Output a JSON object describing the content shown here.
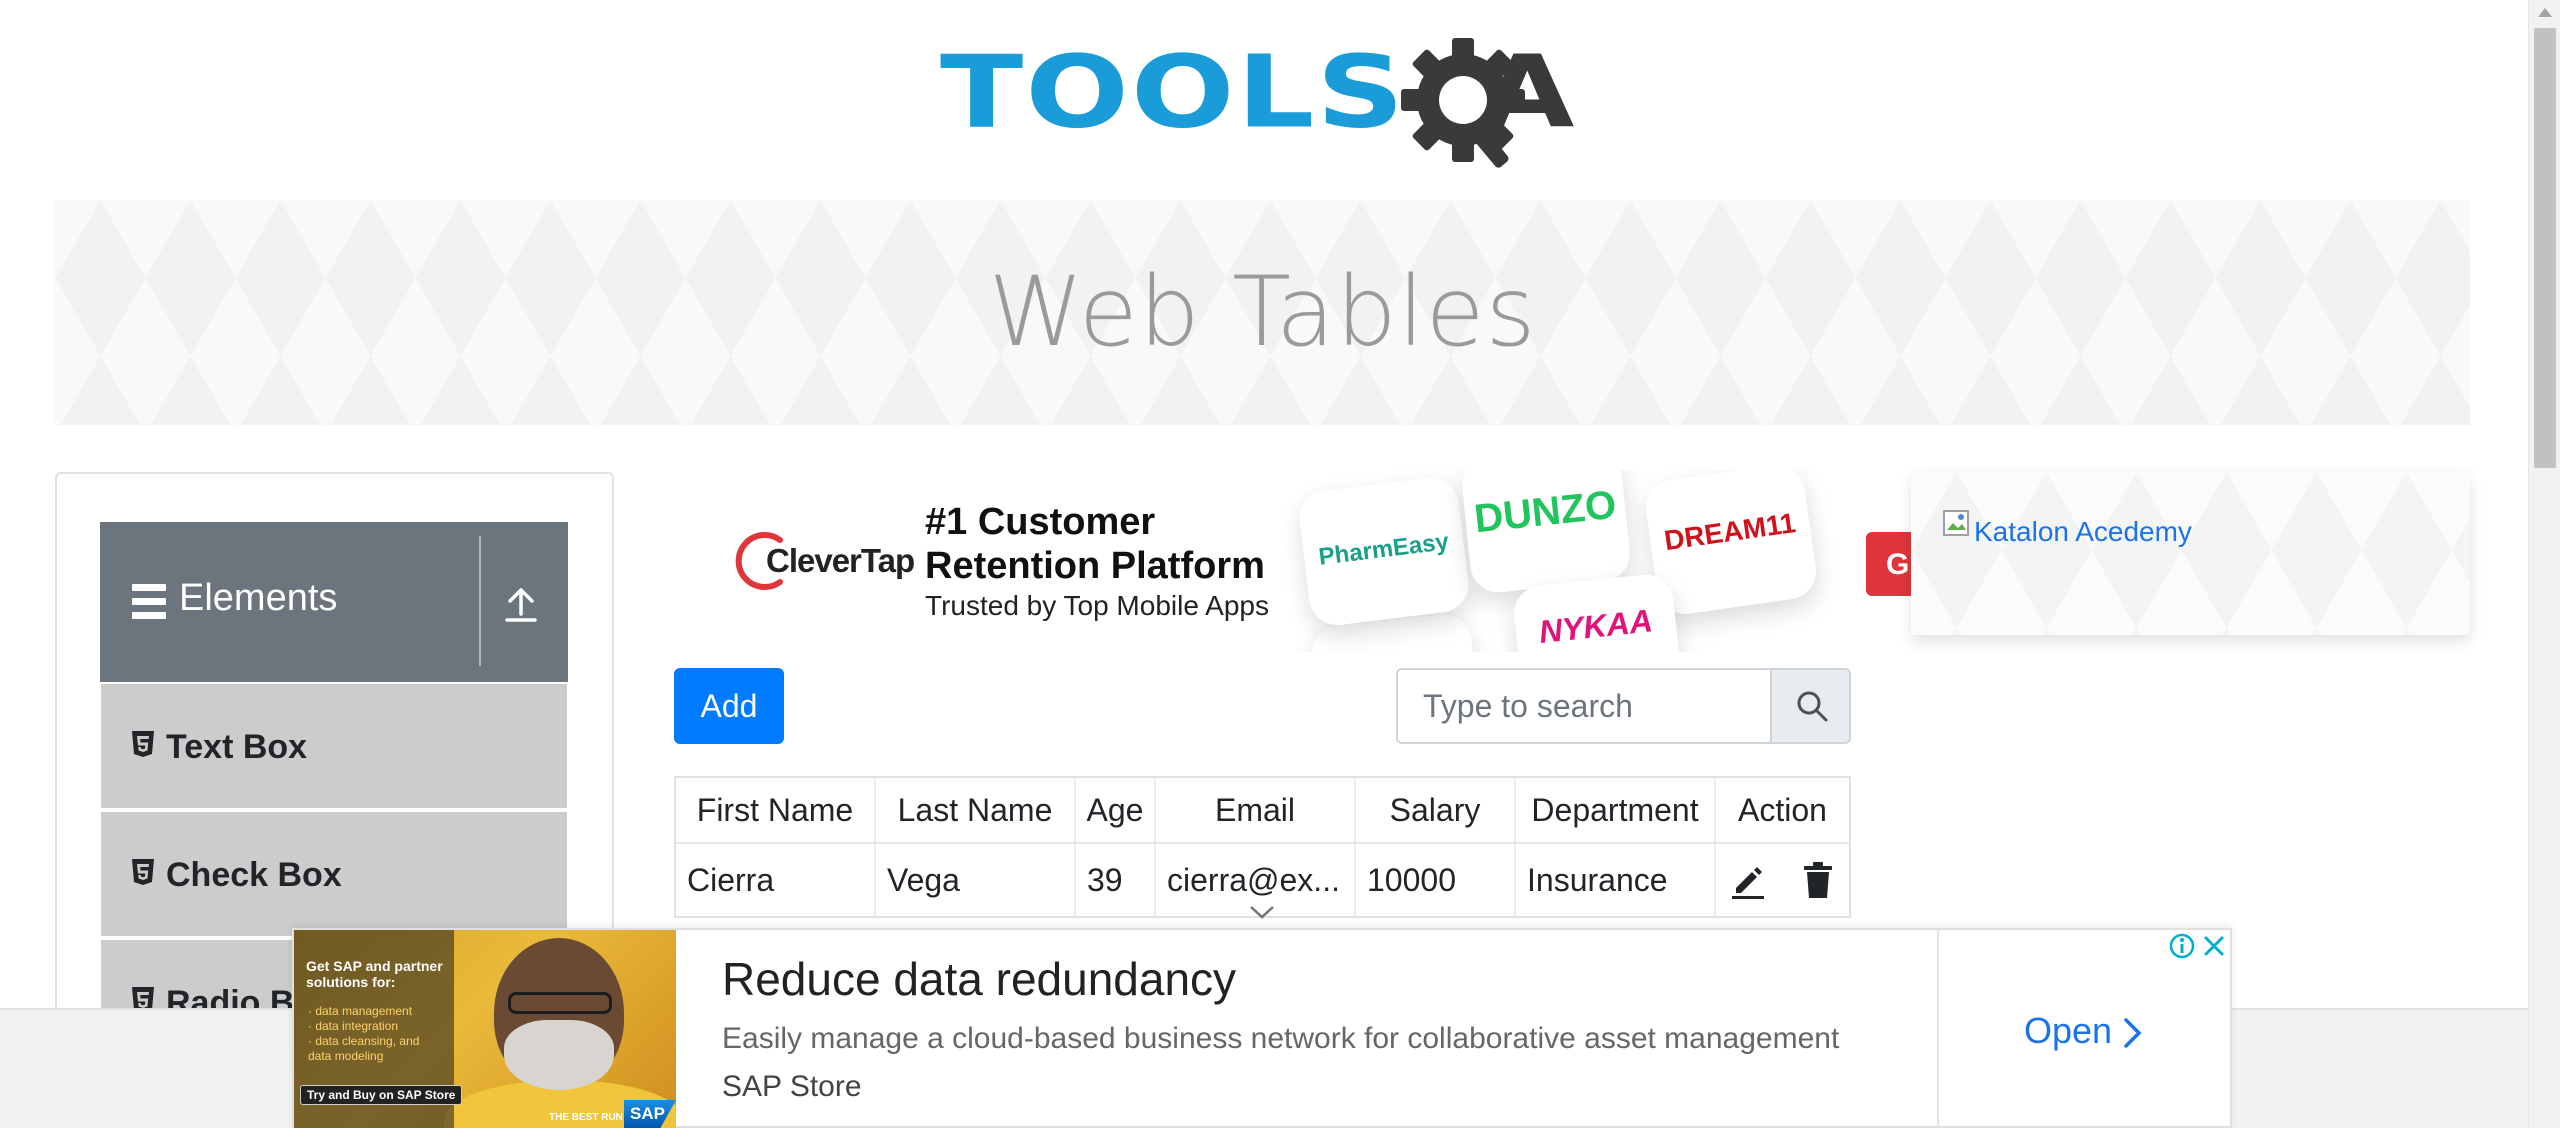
{
  "logo": {
    "text": "TOOLS",
    "letter": "A",
    "colors": {
      "blue": "#1a9cd8",
      "dark": "#3a3a3a"
    },
    "icon": "gear-magnifier-icon"
  },
  "banner": {
    "title": "Web Tables"
  },
  "sidebar": {
    "group": {
      "title": "Elements",
      "icon": "hamburger-icon",
      "toggle_icon": "upload-arrow-icon"
    },
    "items": [
      {
        "label": "Text Box",
        "icon": "html5-icon"
      },
      {
        "label": "Check Box",
        "icon": "html5-icon"
      },
      {
        "label": "Radio Button",
        "icon": "html5-icon"
      }
    ]
  },
  "top_ad": {
    "brand": "CleverTap",
    "headline": "#1 Customer Retention Platform",
    "subline": "Trusted by Top Mobile Apps",
    "apps": [
      "PharmEasy",
      "DUNZO",
      "DREAM11",
      "NYKAA"
    ],
    "cta_letter": "G",
    "colors": {
      "accent": "#e0353a"
    }
  },
  "katalon": {
    "alt_text": "Katalon Acedemy"
  },
  "controls": {
    "add_label": "Add",
    "search_placeholder": "Type to search",
    "colors": {
      "primary": "#007bff"
    }
  },
  "table": {
    "headers": [
      "First Name",
      "Last Name",
      "Age",
      "Email",
      "Salary",
      "Department",
      "Action"
    ],
    "rows": [
      {
        "first_name": "Cierra",
        "last_name": "Vega",
        "age": "39",
        "email": "cierra@ex...",
        "salary": "10000",
        "department": "Insurance"
      }
    ]
  },
  "bottom_ad": {
    "image_title": "Get SAP and partner solutions for:",
    "image_bullets": [
      "· data management",
      "· data integration",
      "· data cleansing, and",
      "  data modeling"
    ],
    "image_cta": "Try and Buy on SAP Store",
    "image_tagline": "THE BEST RUN",
    "image_brand": "SAP",
    "headline": "Reduce data redundancy",
    "description": "Easily manage a cloud-based business network for collaborative asset management",
    "source": "SAP Store",
    "cta": "Open"
  }
}
